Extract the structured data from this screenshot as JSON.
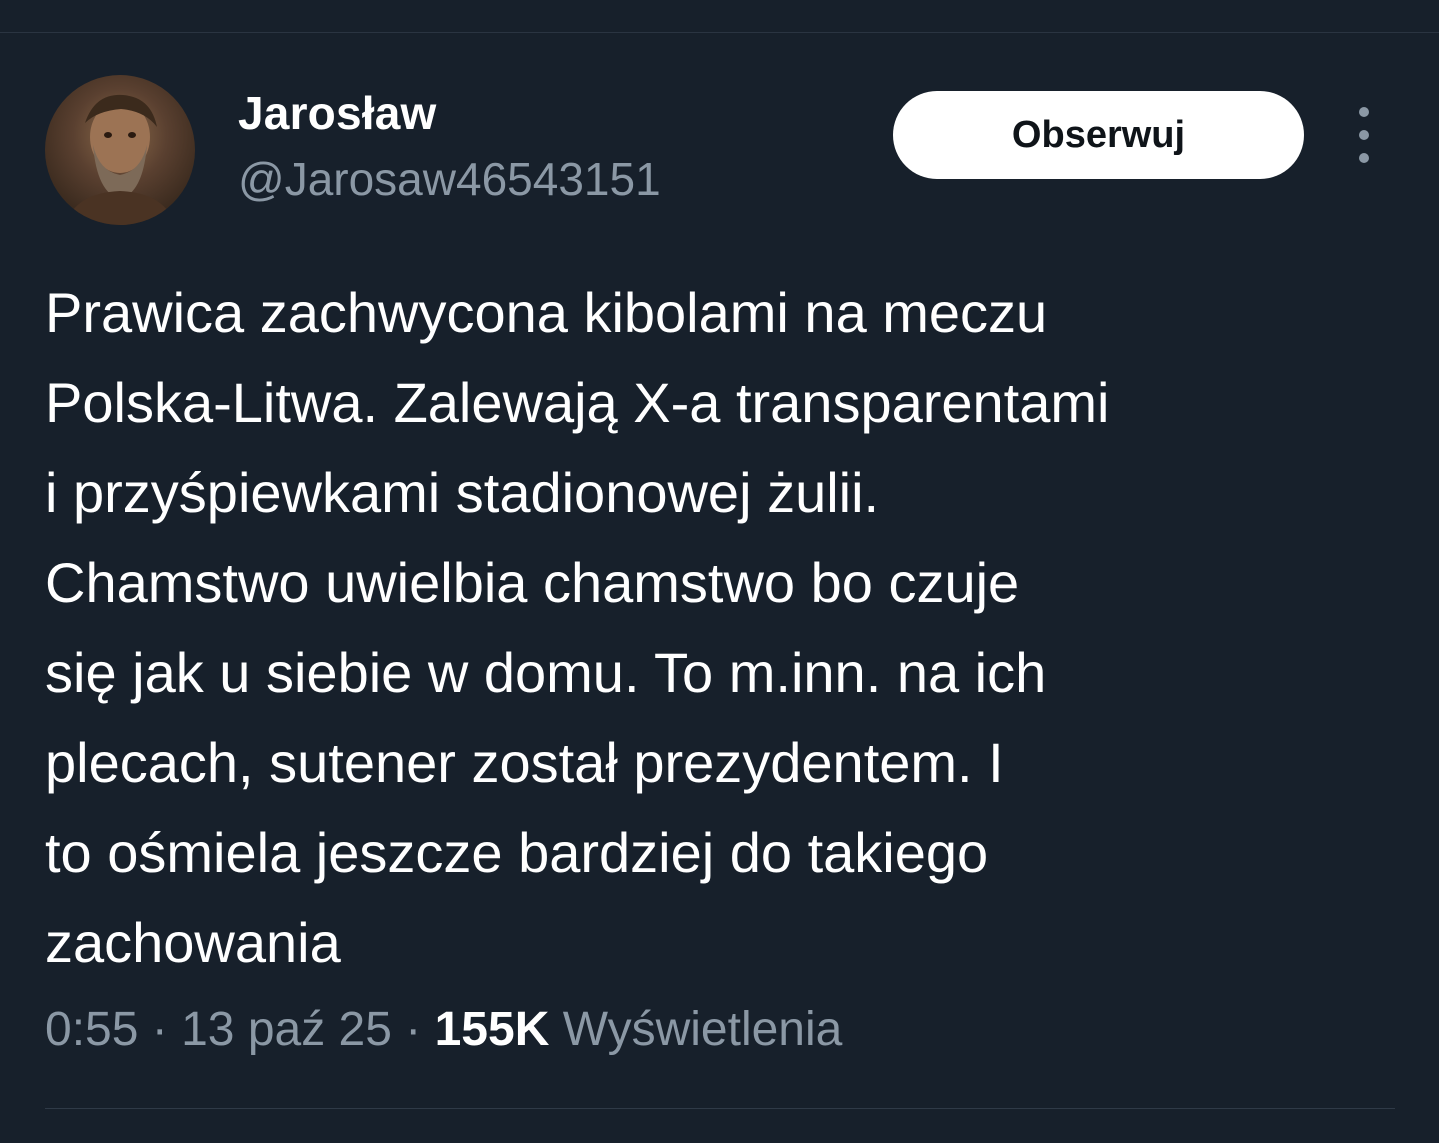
{
  "author": {
    "display_name": "Jarosław",
    "handle": "@Jarosaw46543151"
  },
  "actions": {
    "follow_label": "Obserwuj"
  },
  "tweet": {
    "lines": [
      "Prawica zachwycona kibolami na meczu",
      "Polska-Litwa. Zalewają X-a transparentami",
      "i przyśpiewkami stadionowej żulii.",
      "Chamstwo uwielbia chamstwo bo czuje",
      "się jak u siebie w domu. To m.inn. na ich",
      "plecach, sutener został prezydentem. I",
      "to ośmiela jeszcze bardziej do takiego",
      "zachowania"
    ]
  },
  "meta": {
    "time": "0:55",
    "separator": "·",
    "date": "13 paź 25",
    "views_count": "155K",
    "views_label": "Wyświetlenia"
  },
  "colors": {
    "background": "#17202b",
    "secondary_text": "#8b98a5",
    "primary_text": "#ffffff"
  },
  "icons": {
    "more": "more-vertical-icon"
  }
}
